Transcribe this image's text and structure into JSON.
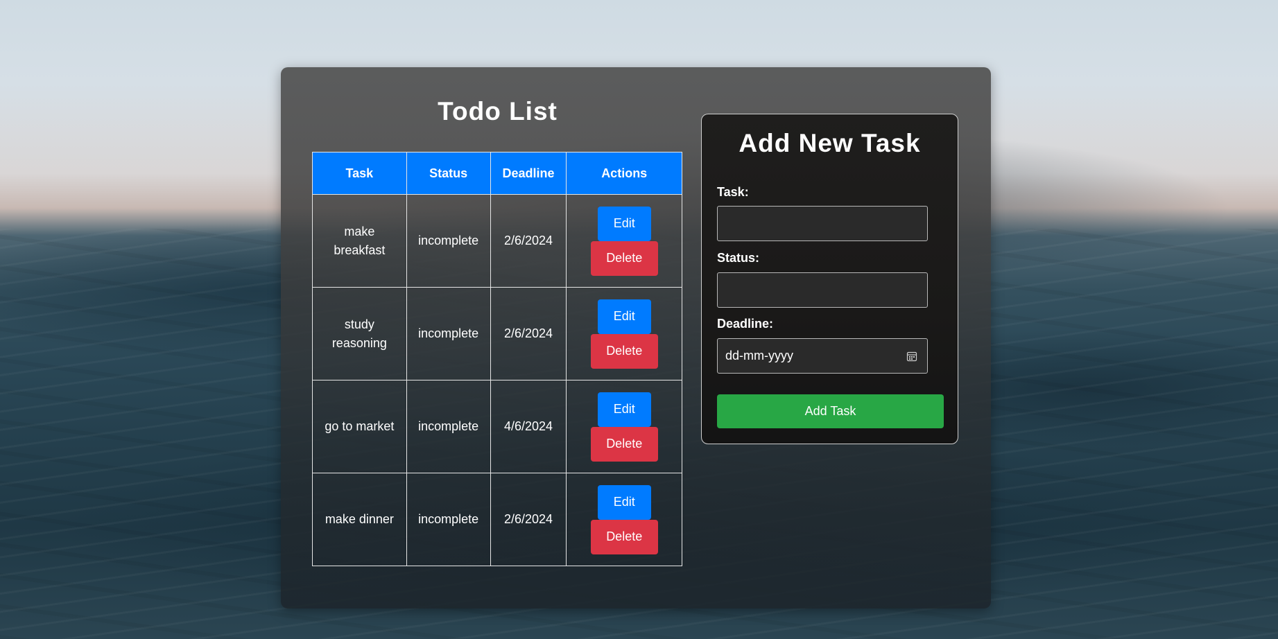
{
  "todo": {
    "title": "Todo List",
    "columns": [
      "Task",
      "Status",
      "Deadline",
      "Actions"
    ],
    "rows": [
      {
        "task": "make breakfast",
        "status": "incomplete",
        "deadline": "2/6/2024",
        "edit_label": "Edit",
        "delete_label": "Delete"
      },
      {
        "task": "study reasoning",
        "status": "incomplete",
        "deadline": "2/6/2024",
        "edit_label": "Edit",
        "delete_label": "Delete"
      },
      {
        "task": "go to market",
        "status": "incomplete",
        "deadline": "4/6/2024",
        "edit_label": "Edit",
        "delete_label": "Delete"
      },
      {
        "task": "make dinner",
        "status": "incomplete",
        "deadline": "2/6/2024",
        "edit_label": "Edit",
        "delete_label": "Delete"
      }
    ]
  },
  "form": {
    "title": "Add New Task",
    "task_label": "Task:",
    "task_value": "",
    "status_label": "Status:",
    "status_value": "",
    "deadline_label": "Deadline:",
    "deadline_placeholder": "dd-mm-yyyy",
    "submit_label": "Add Task",
    "calendar_icon": "calendar-icon"
  },
  "colors": {
    "header_blue": "#007bff",
    "edit_blue": "#007bff",
    "delete_red": "#dc3545",
    "add_green": "#28a745"
  }
}
